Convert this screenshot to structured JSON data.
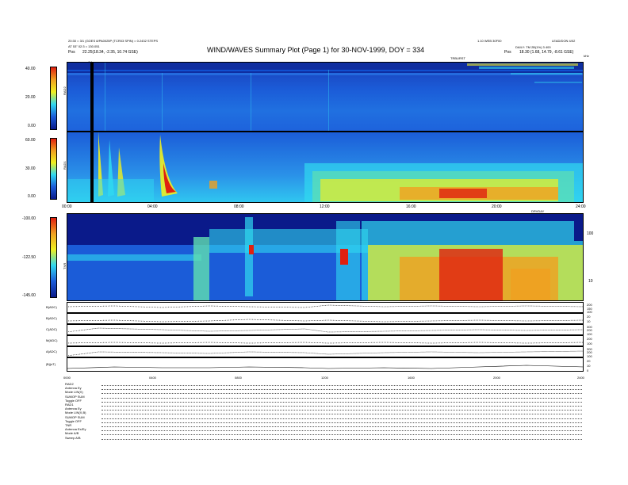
{
  "header": {
    "title": "WIND/WAVES Summary Plot (Page 1) for 30-NOV-1999, DOY = 334",
    "left_line1": "20:30 = 3/1 (GOES 8/PA0025P (TCR03 SPIN) = 0.2432 STEPS",
    "left_line2": "AT 53\" 02:3 = 130.051",
    "left_line3_label": "Pos",
    "left_line3_value": "22.25(18.34, -2.35, 10.74 GSE)",
    "right_line1": "1.10 WEB 30F00",
    "right_line1b": "LEAD/DON 4/02",
    "right_line2": "DAILY: TM 2B(1%) 3 400",
    "right_line3_label": "Pos",
    "right_line3_value": "18.30 (1.68, 14.79, -8.61 GSE)",
    "marker_label": "C4",
    "right_marker": "TRBURST",
    "right_corner": "kHz"
  },
  "panels": {
    "rad2": {
      "label": "RAD2",
      "ticks": [
        "40.00",
        "20.00",
        "0.00"
      ]
    },
    "rad1": {
      "label": "RAD1",
      "ticks": [
        "60.00",
        "30.00",
        "0.00"
      ]
    },
    "tnr": {
      "label": "TNR",
      "ticks": [
        "-100.00",
        "-122.50",
        "-145.00"
      ],
      "right_ticks": [
        "100",
        "10"
      ],
      "right_label": "kHz"
    }
  },
  "time_axis_1": [
    "00:00",
    "04:00",
    "08:00",
    "12:00",
    "16:00",
    "20:00",
    "24:00"
  ],
  "time_axis_1_extra": "DRVDAY",
  "time_axis_2": [
    "0000",
    "0400",
    "0800",
    "1200",
    "1600",
    "2000",
    "2400"
  ],
  "strips": [
    {
      "label": "B(ADC)",
      "right_ticks": [
        "200",
        "150",
        "100"
      ]
    },
    {
      "label": "B(ADC)",
      "right_ticks": [
        "20",
        "10"
      ]
    },
    {
      "label": "C(ADC)",
      "right_ticks": [
        "300",
        "200",
        "100"
      ]
    },
    {
      "label": "M(ADC)",
      "right_ticks": [
        "200",
        "100"
      ]
    },
    {
      "label": "A(ADC)",
      "right_ticks": [
        "300",
        "200",
        "100"
      ]
    },
    {
      "label": "|B|(nT)",
      "right_ticks": [
        "20",
        "10",
        "0"
      ]
    }
  ],
  "footer": [
    {
      "label": "RAD2"
    },
    {
      "label": "Antenna     Ey"
    },
    {
      "label": "Mode    LIN(X)"
    },
    {
      "label": "SUMOP   SUM"
    },
    {
      "label": "Toggle     OFF"
    },
    {
      "label": "RAD1"
    },
    {
      "label": "Antenna     Ey"
    },
    {
      "label": "Mode    LIN(X,B)"
    },
    {
      "label": "SUMOP   SUM"
    },
    {
      "label": "Toggle     OFF"
    },
    {
      "label": "TNR"
    },
    {
      "label": "Antenna     Ex/Ey"
    },
    {
      "label": "Mode    A/B"
    },
    {
      "label": "Sweep   A/B"
    }
  ],
  "chart_data": {
    "type": "heatmap",
    "title": "WIND/WAVES Summary Plot (Page 1) for 30-NOV-1999, DOY = 334",
    "x_range": [
      "00:00",
      "24:00"
    ],
    "panels": [
      "RAD2",
      "RAD1",
      "TNR"
    ],
    "strip_series": [
      "B(ADC)",
      "B(ADC)",
      "C(ADC)",
      "M(ADC)",
      "A(ADC)",
      "|B|(nT)"
    ]
  },
  "colors": {
    "bg_blue": "#1b5cd8",
    "dark_blue": "#0a1a8a",
    "cyan": "#30d8f0",
    "yellow": "#f0f020",
    "red": "#e02010"
  }
}
